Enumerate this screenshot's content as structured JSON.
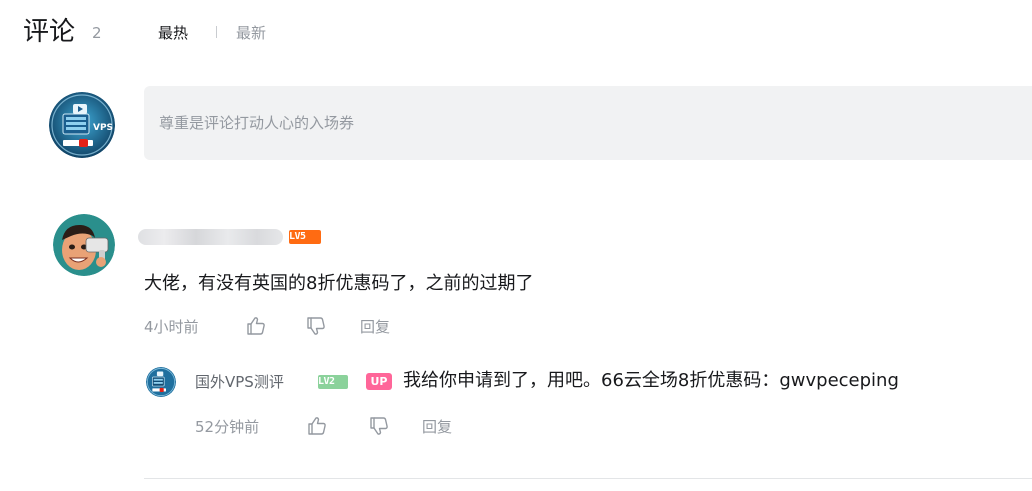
{
  "header": {
    "title": "评论",
    "count": "2",
    "tabs": [
      {
        "label": "最热",
        "active": true
      },
      {
        "label": "最新",
        "active": false
      }
    ]
  },
  "composer": {
    "placeholder": "尊重是评论打动人心的入场券",
    "avatar_icon": "vps-logo-avatar-icon"
  },
  "comments": [
    {
      "avatar_icon": "cartoon-man-avatar-icon",
      "username_blurred": true,
      "level": "LV5",
      "level_color": "#ff6b12",
      "text": "大佬，有没有英国的8折优惠码了，之前的过期了",
      "time": "4小时前",
      "reply_label": "回复",
      "replies": [
        {
          "avatar_icon": "vps-logo-avatar-icon",
          "username": "国外VPS测评",
          "level": "LV2",
          "level_color": "#8bd29b",
          "badge": "UP",
          "badge_color": "#ff6699",
          "text": "我给你申请到了，用吧。66云全场8折优惠码：gwvpeceping",
          "time": "52分钟前",
          "reply_label": "回复"
        }
      ]
    }
  ],
  "colors": {
    "text_primary": "#18191c",
    "text_secondary": "#9499a0",
    "input_bg": "#f1f2f3",
    "divider": "#e3e5e7"
  }
}
